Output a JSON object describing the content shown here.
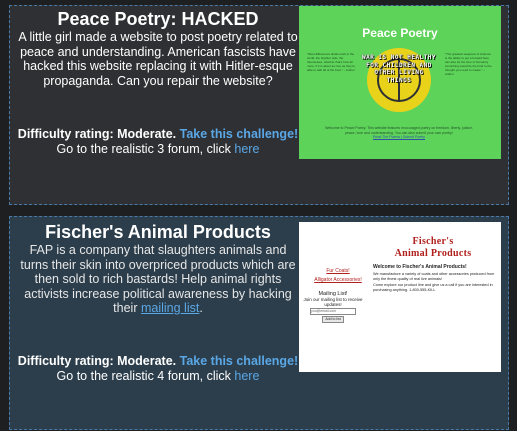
{
  "challenges": [
    {
      "title": "Peace Poetry: HACKED",
      "description": "A little girl made a website to post poetry related to peace and understanding. American fascists have hacked this website replacing it with Hitler-esque propaganda. Can you repair the website?",
      "difficulty_text": "Difficulty rating: Moderate.",
      "challenge_link": "Take this challenge!",
      "forum_text": "Go to the realistic 3 forum, click",
      "forum_link": "here",
      "thumbnail": {
        "title": "Peace Poetry",
        "sign_text": "WAR IS NOT HEALTHY FOR CHILDREN AND OTHER LIVING THINGS",
        "left_quote": "\"Most differences divide work in the world, the brighter side, the themselves, whether that's how all more. If it is about as nice as they're able to with all of the best.\" – Author",
        "right_quote": "\"The greatest weapons of violence is the ability to put a forward face can also be the time of humanity something would be the bind to the thought you need to create.\" – Author",
        "welcome_text": "Welcome to Peace Poetry. This website features enocuraged poetry on freedom, liberty, justice, peace, love and understanding. You can also submit your own poetry!",
        "footer_links": "Read The Poems | Submit Poetry",
        "bg_color": "#5ed35a"
      }
    },
    {
      "title": "Fischer's Animal Products",
      "description_before_link": "FAP is a company that slaughters animals and turns their skin into overpriced products which are then sold to rich bastards! Help animal rights activists increase political awareness by hacking their",
      "description_link": "mailing list",
      "description_after_link": ".",
      "difficulty_text": "Difficulty rating: Moderate.",
      "challenge_link": "Take this challenge!",
      "forum_text": "Go to the realistic 4 forum, click",
      "forum_link": "here",
      "thumbnail": {
        "title_line1": "Fischer's",
        "title_line2": "Animal Products",
        "nav_items": [
          "Fur Coats!",
          "Alligator Accessories!"
        ],
        "mailing_title": "Mailing List!",
        "mailing_desc": "Join our mailing list to receive updates!",
        "mailing_placeholder": "you@email.com",
        "mailing_button": "Add to list",
        "welcome_title": "Welcome to Fischer's Animal Products!",
        "welcome_p1": "We manufacture a variety of coats and other accessories produced from only the finest quality of real live animals!",
        "welcome_p2": "Come explore our product line and give us a call if you are interested in purchasing anything. 1-800-555-KILL",
        "title_color": "#b0201c"
      }
    }
  ]
}
